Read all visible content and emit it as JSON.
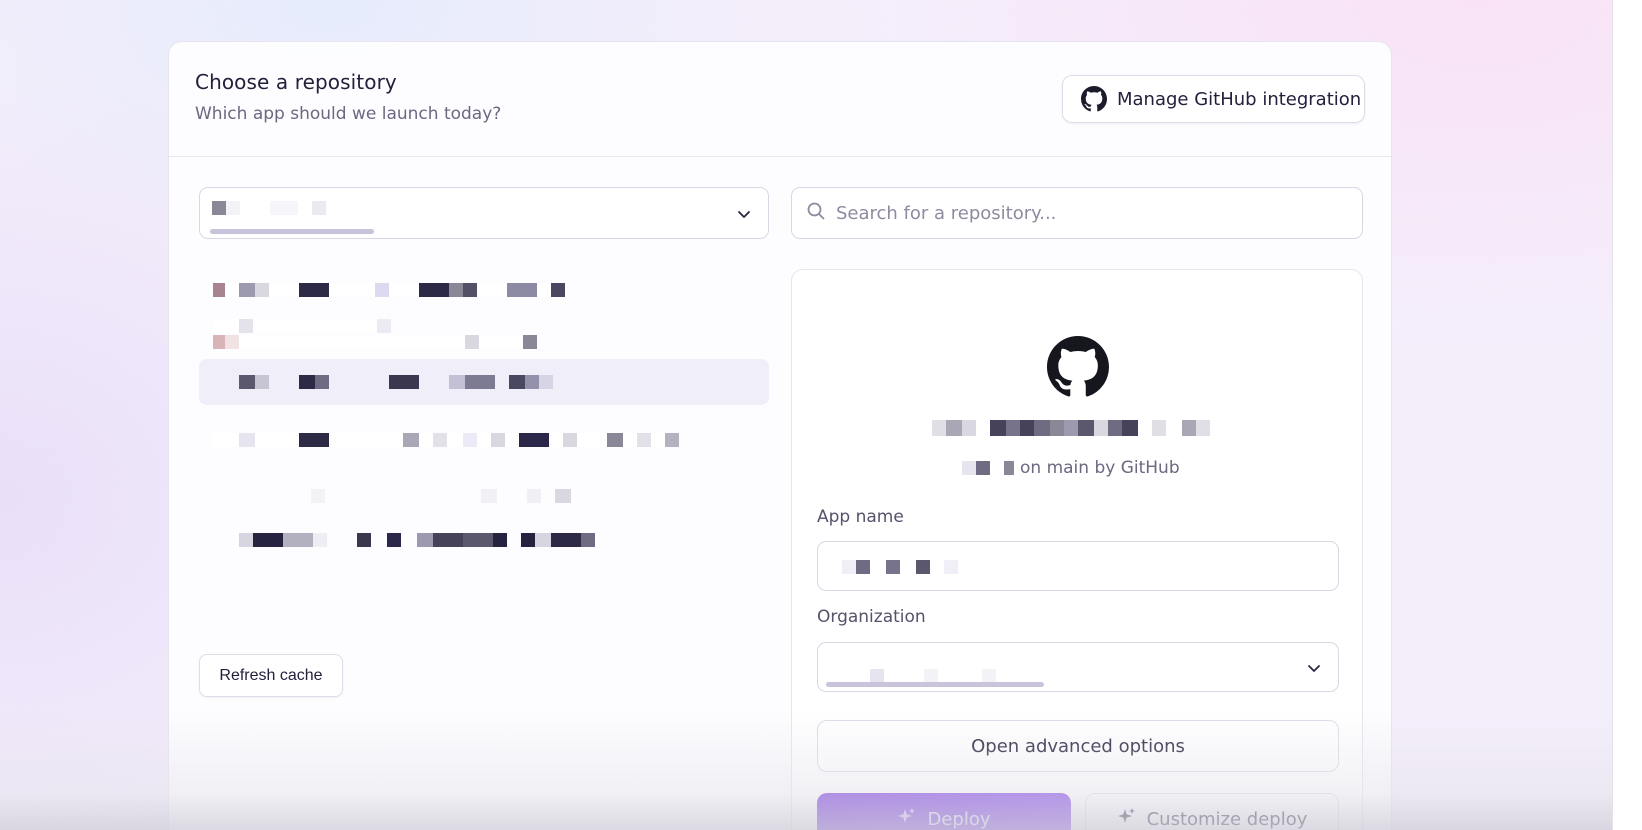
{
  "header": {
    "title": "Choose a repository",
    "subtitle": "Which app should we launch today?",
    "manage_github_label": "Manage GitHub integration"
  },
  "search": {
    "placeholder": "Search for a repository..."
  },
  "repo_list": {
    "refresh_label": "Refresh cache"
  },
  "detail": {
    "repo_meta_suffix": "on main by GitHub",
    "app_name_label": "App name",
    "organization_label": "Organization",
    "advanced_label": "Open advanced options",
    "deploy_label": "Deploy",
    "customize_label": "Customize deploy"
  },
  "colors": {
    "accent": "#6d2bd9",
    "border": "#d9d7e3"
  },
  "icons": [
    "github-icon",
    "search-icon",
    "chevron-down-icon",
    "sparkle-icon"
  ]
}
